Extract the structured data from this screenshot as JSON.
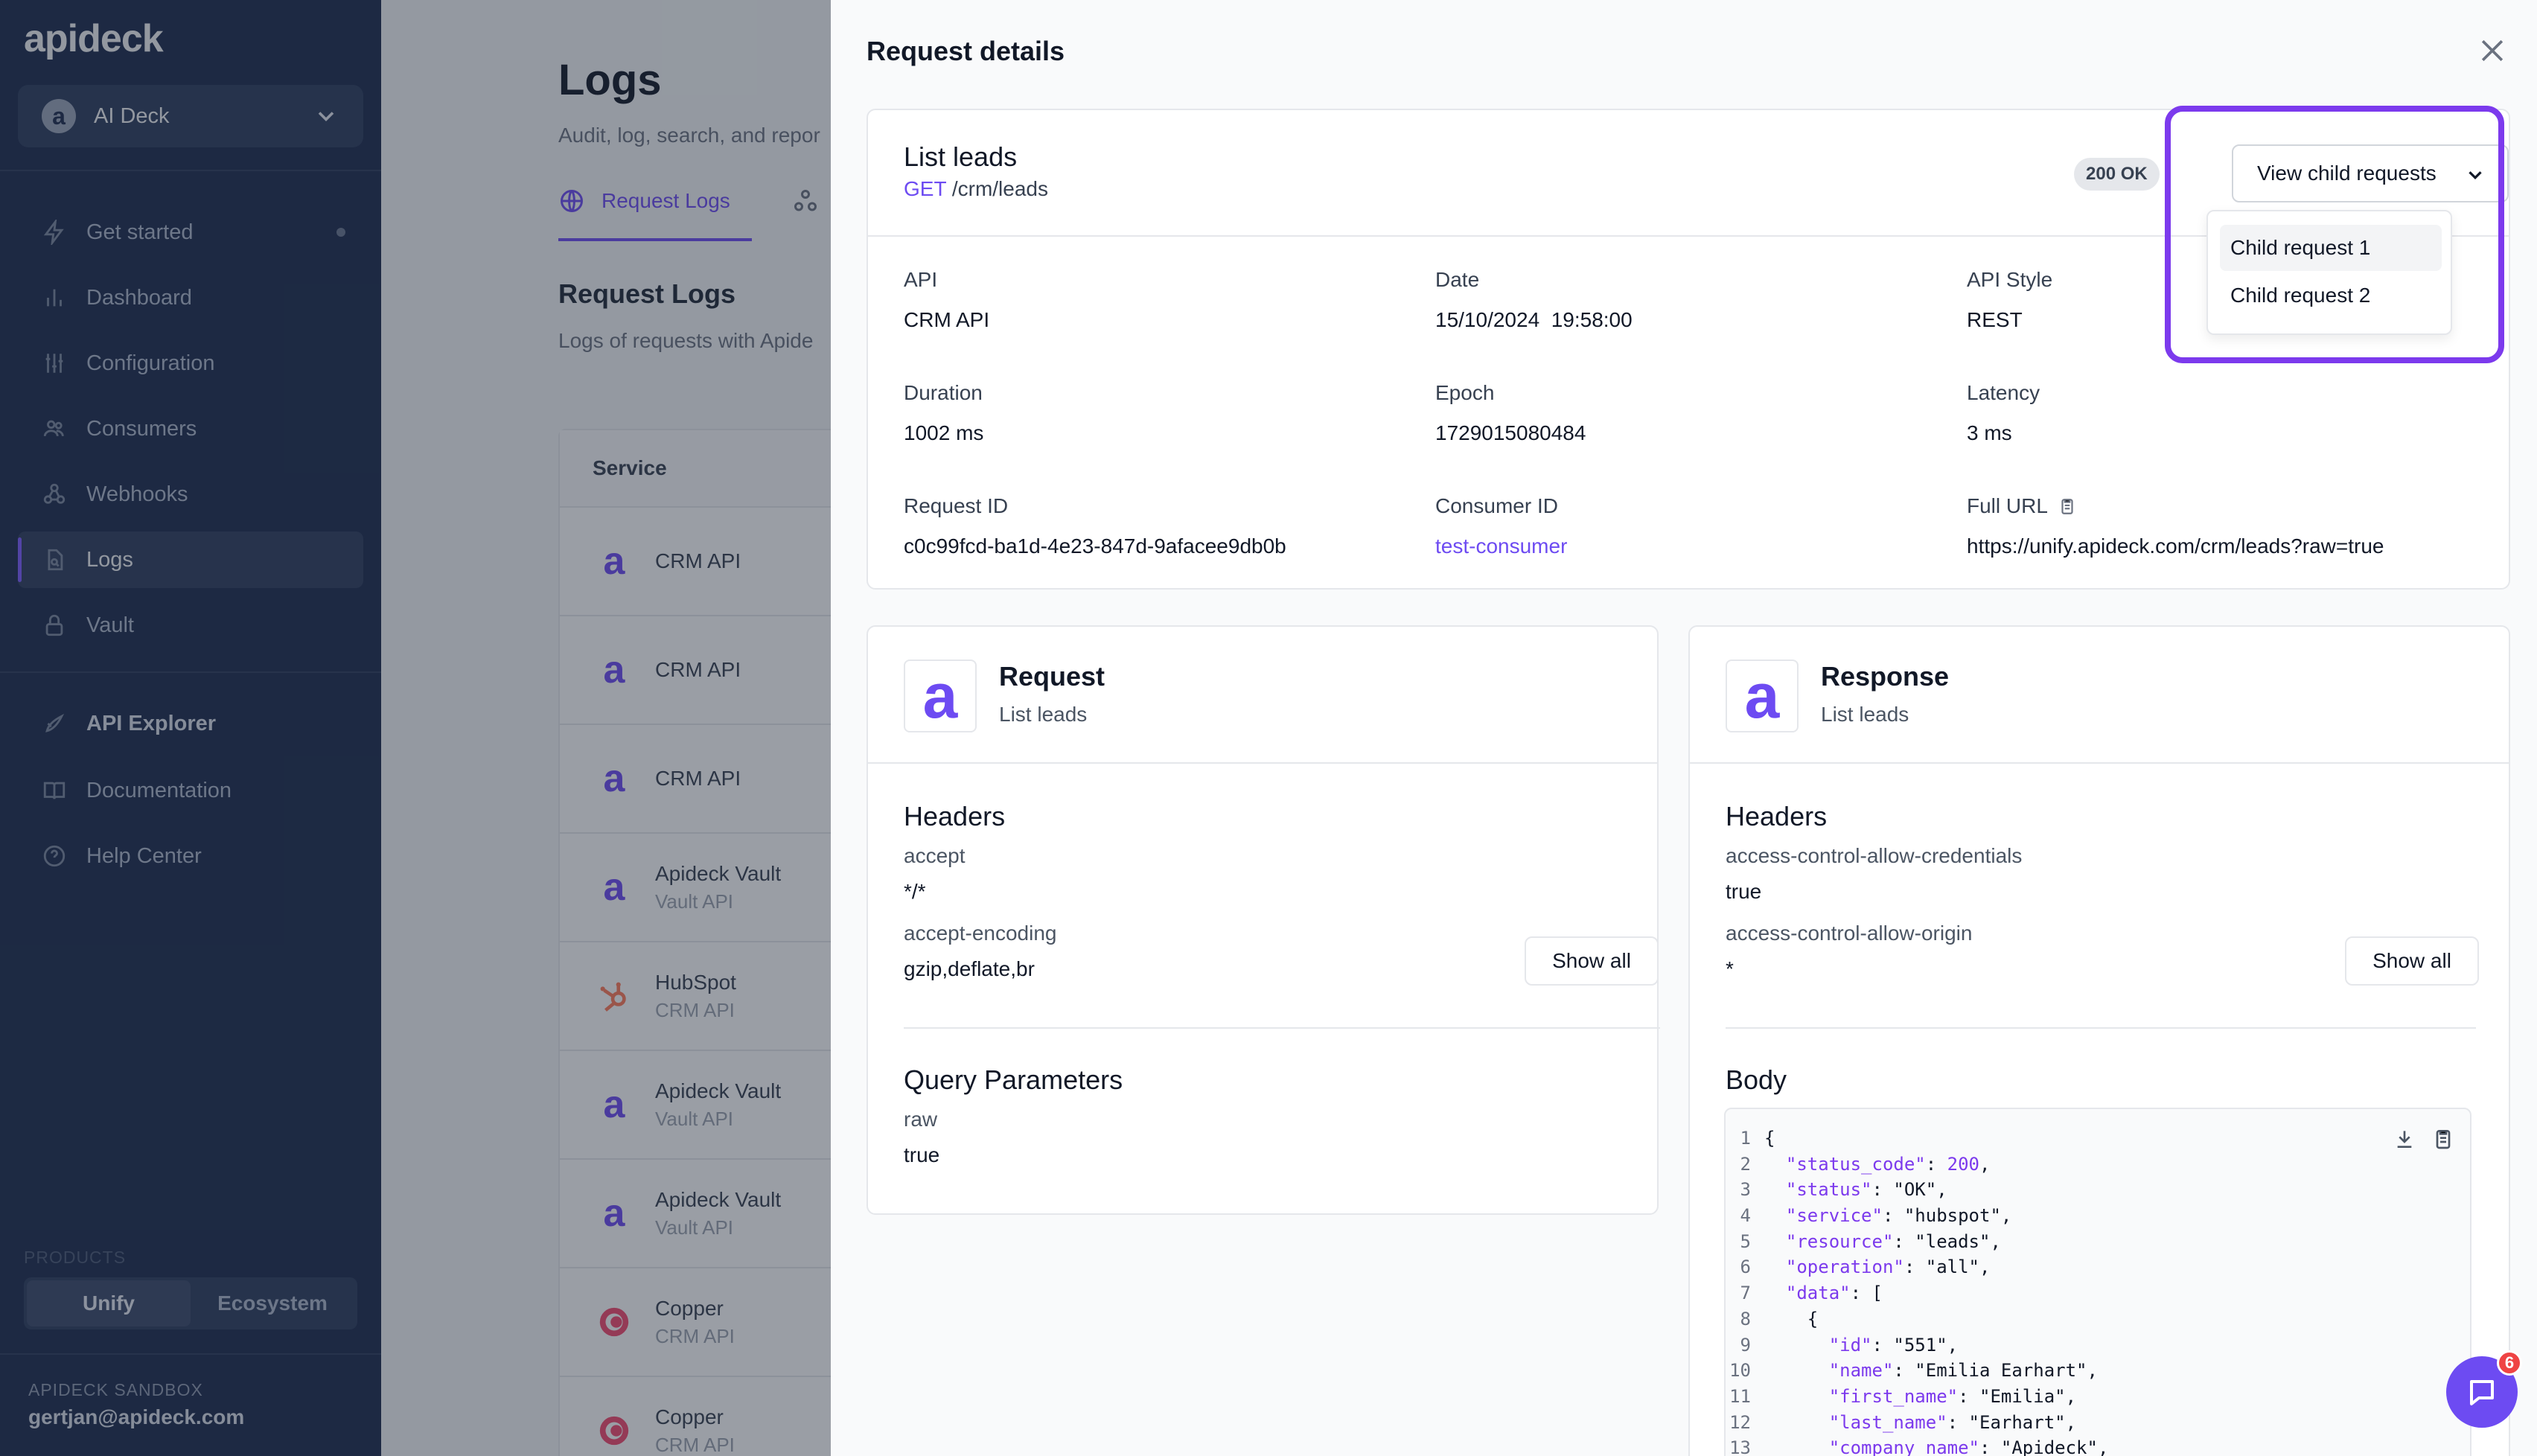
{
  "sidebar": {
    "logo": "apideck",
    "workspace": {
      "avatar": "a",
      "name": "AI Deck"
    },
    "nav": [
      {
        "label": "Get started",
        "icon": "bolt-icon"
      },
      {
        "label": "Dashboard",
        "icon": "bar-chart-icon"
      },
      {
        "label": "Configuration",
        "icon": "sliders-icon"
      },
      {
        "label": "Consumers",
        "icon": "users-icon"
      },
      {
        "label": "Webhooks",
        "icon": "webhook-icon"
      },
      {
        "label": "Logs",
        "icon": "document-search-icon",
        "active": true
      },
      {
        "label": "Vault",
        "icon": "lock-icon"
      }
    ],
    "nav2": [
      {
        "label": "API Explorer",
        "icon": "rocket-icon"
      },
      {
        "label": "Documentation",
        "icon": "book-icon"
      },
      {
        "label": "Help Center",
        "icon": "help-circle-icon"
      }
    ],
    "products_label": "PRODUCTS",
    "products": [
      "Unify",
      "Ecosystem"
    ],
    "sandbox_label": "APIDECK SANDBOX",
    "email": "gertjan@apideck.com"
  },
  "logs_page": {
    "title": "Logs",
    "subtitle": "Audit, log, search, and repor",
    "tab_active": "Request Logs",
    "section_title": "Request Logs",
    "section_desc": "Logs of requests with Apide",
    "table_header": "Service",
    "rows": [
      {
        "name": "CRM API",
        "sub": "",
        "icon": "a"
      },
      {
        "name": "CRM API",
        "sub": "",
        "icon": "a"
      },
      {
        "name": "CRM API",
        "sub": "",
        "icon": "a"
      },
      {
        "name": "Apideck Vault",
        "sub": "Vault API",
        "icon": "a"
      },
      {
        "name": "HubSpot",
        "sub": "CRM API",
        "icon": "hubspot"
      },
      {
        "name": "Apideck Vault",
        "sub": "Vault API",
        "icon": "a"
      },
      {
        "name": "Apideck Vault",
        "sub": "Vault API",
        "icon": "a"
      },
      {
        "name": "Copper",
        "sub": "CRM API",
        "icon": "copper"
      },
      {
        "name": "Copper",
        "sub": "CRM API",
        "icon": "copper"
      }
    ]
  },
  "panel": {
    "title": "Request details",
    "summary": {
      "name": "List leads",
      "method": "GET",
      "path": "/crm/leads",
      "status": "200 OK",
      "child_button": "View child requests",
      "child_menu": [
        "Child request 1",
        "Child request 2"
      ],
      "fields": [
        {
          "label": "API",
          "value": "CRM API"
        },
        {
          "label": "Date",
          "value": "15/10/2024  19:58:00"
        },
        {
          "label": "API Style",
          "value": "REST"
        },
        {
          "label": "Duration",
          "value": "1002 ms"
        },
        {
          "label": "Epoch",
          "value": "1729015080484"
        },
        {
          "label": "Latency",
          "value": "3 ms"
        },
        {
          "label": "Request ID",
          "value": "c0c99fcd-ba1d-4e23-847d-9afacee9db0b"
        },
        {
          "label": "Consumer ID",
          "value": "test-consumer"
        },
        {
          "label": "Full URL",
          "value": "https://unify.apideck.com/crm/leads?raw=true"
        }
      ]
    },
    "request": {
      "title": "Request",
      "subtitle": "List leads",
      "headers_title": "Headers",
      "headers": [
        {
          "key": "accept",
          "value": "*/*"
        },
        {
          "key": "accept-encoding",
          "value": "gzip,deflate,br"
        }
      ],
      "show_all": "Show all",
      "query_title": "Query Parameters",
      "query": [
        {
          "key": "raw",
          "value": "true"
        }
      ]
    },
    "response": {
      "title": "Response",
      "subtitle": "List leads",
      "headers_title": "Headers",
      "headers": [
        {
          "key": "access-control-allow-credentials",
          "value": "true"
        },
        {
          "key": "access-control-allow-origin",
          "value": "*"
        }
      ],
      "show_all": "Show all",
      "body_title": "Body",
      "body_lines": [
        {
          "n": "1",
          "t": "{"
        },
        {
          "n": "2",
          "t": "  \"status_code\": 200,"
        },
        {
          "n": "3",
          "t": "  \"status\": \"OK\","
        },
        {
          "n": "4",
          "t": "  \"service\": \"hubspot\","
        },
        {
          "n": "5",
          "t": "  \"resource\": \"leads\","
        },
        {
          "n": "6",
          "t": "  \"operation\": \"all\","
        },
        {
          "n": "7",
          "t": "  \"data\": ["
        },
        {
          "n": "8",
          "t": "    {"
        },
        {
          "n": "9",
          "t": "      \"id\": \"551\","
        },
        {
          "n": "10",
          "t": "      \"name\": \"Emilia Earhart\","
        },
        {
          "n": "11",
          "t": "      \"first_name\": \"Emilia\","
        },
        {
          "n": "12",
          "t": "      \"last_name\": \"Earhart\","
        },
        {
          "n": "13",
          "t": "      \"company_name\": \"Apideck\","
        }
      ]
    }
  },
  "chat_badge": "6",
  "colors": {
    "accent": "#6d4bf2",
    "highlight": "#7c3aed",
    "sidebar": "#1c2b4d"
  }
}
